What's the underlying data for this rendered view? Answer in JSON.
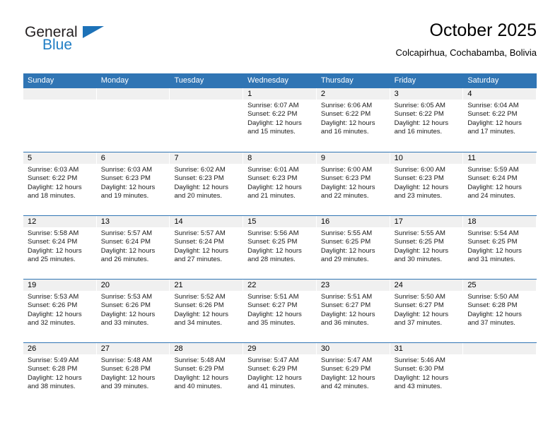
{
  "brand": {
    "name_part1": "General",
    "name_part2": "Blue",
    "triangle_color": "#1d72b8",
    "text_color": "#231f20",
    "blue_color": "#1f7dc4"
  },
  "header": {
    "title": "October 2025",
    "subtitle": "Colcapirhua, Cochabamba, Bolivia"
  },
  "theme": {
    "header_bar": "#3075b4",
    "day_strip": "#f0f0f0",
    "separator": "#3075b4",
    "page_bg": "#ffffff"
  },
  "weekdays": [
    "Sunday",
    "Monday",
    "Tuesday",
    "Wednesday",
    "Thursday",
    "Friday",
    "Saturday"
  ],
  "weeks": [
    [
      {
        "date": "",
        "empty": true,
        "sunrise": "",
        "sunset": "",
        "daylight_line1": "",
        "daylight_line2": ""
      },
      {
        "date": "",
        "empty": true,
        "sunrise": "",
        "sunset": "",
        "daylight_line1": "",
        "daylight_line2": ""
      },
      {
        "date": "",
        "empty": true,
        "sunrise": "",
        "sunset": "",
        "daylight_line1": "",
        "daylight_line2": ""
      },
      {
        "date": "1",
        "empty": false,
        "sunrise": "Sunrise: 6:07 AM",
        "sunset": "Sunset: 6:22 PM",
        "daylight_line1": "Daylight: 12 hours",
        "daylight_line2": "and 15 minutes."
      },
      {
        "date": "2",
        "empty": false,
        "sunrise": "Sunrise: 6:06 AM",
        "sunset": "Sunset: 6:22 PM",
        "daylight_line1": "Daylight: 12 hours",
        "daylight_line2": "and 16 minutes."
      },
      {
        "date": "3",
        "empty": false,
        "sunrise": "Sunrise: 6:05 AM",
        "sunset": "Sunset: 6:22 PM",
        "daylight_line1": "Daylight: 12 hours",
        "daylight_line2": "and 16 minutes."
      },
      {
        "date": "4",
        "empty": false,
        "sunrise": "Sunrise: 6:04 AM",
        "sunset": "Sunset: 6:22 PM",
        "daylight_line1": "Daylight: 12 hours",
        "daylight_line2": "and 17 minutes."
      }
    ],
    [
      {
        "date": "5",
        "empty": false,
        "sunrise": "Sunrise: 6:03 AM",
        "sunset": "Sunset: 6:22 PM",
        "daylight_line1": "Daylight: 12 hours",
        "daylight_line2": "and 18 minutes."
      },
      {
        "date": "6",
        "empty": false,
        "sunrise": "Sunrise: 6:03 AM",
        "sunset": "Sunset: 6:23 PM",
        "daylight_line1": "Daylight: 12 hours",
        "daylight_line2": "and 19 minutes."
      },
      {
        "date": "7",
        "empty": false,
        "sunrise": "Sunrise: 6:02 AM",
        "sunset": "Sunset: 6:23 PM",
        "daylight_line1": "Daylight: 12 hours",
        "daylight_line2": "and 20 minutes."
      },
      {
        "date": "8",
        "empty": false,
        "sunrise": "Sunrise: 6:01 AM",
        "sunset": "Sunset: 6:23 PM",
        "daylight_line1": "Daylight: 12 hours",
        "daylight_line2": "and 21 minutes."
      },
      {
        "date": "9",
        "empty": false,
        "sunrise": "Sunrise: 6:00 AM",
        "sunset": "Sunset: 6:23 PM",
        "daylight_line1": "Daylight: 12 hours",
        "daylight_line2": "and 22 minutes."
      },
      {
        "date": "10",
        "empty": false,
        "sunrise": "Sunrise: 6:00 AM",
        "sunset": "Sunset: 6:23 PM",
        "daylight_line1": "Daylight: 12 hours",
        "daylight_line2": "and 23 minutes."
      },
      {
        "date": "11",
        "empty": false,
        "sunrise": "Sunrise: 5:59 AM",
        "sunset": "Sunset: 6:24 PM",
        "daylight_line1": "Daylight: 12 hours",
        "daylight_line2": "and 24 minutes."
      }
    ],
    [
      {
        "date": "12",
        "empty": false,
        "sunrise": "Sunrise: 5:58 AM",
        "sunset": "Sunset: 6:24 PM",
        "daylight_line1": "Daylight: 12 hours",
        "daylight_line2": "and 25 minutes."
      },
      {
        "date": "13",
        "empty": false,
        "sunrise": "Sunrise: 5:57 AM",
        "sunset": "Sunset: 6:24 PM",
        "daylight_line1": "Daylight: 12 hours",
        "daylight_line2": "and 26 minutes."
      },
      {
        "date": "14",
        "empty": false,
        "sunrise": "Sunrise: 5:57 AM",
        "sunset": "Sunset: 6:24 PM",
        "daylight_line1": "Daylight: 12 hours",
        "daylight_line2": "and 27 minutes."
      },
      {
        "date": "15",
        "empty": false,
        "sunrise": "Sunrise: 5:56 AM",
        "sunset": "Sunset: 6:25 PM",
        "daylight_line1": "Daylight: 12 hours",
        "daylight_line2": "and 28 minutes."
      },
      {
        "date": "16",
        "empty": false,
        "sunrise": "Sunrise: 5:55 AM",
        "sunset": "Sunset: 6:25 PM",
        "daylight_line1": "Daylight: 12 hours",
        "daylight_line2": "and 29 minutes."
      },
      {
        "date": "17",
        "empty": false,
        "sunrise": "Sunrise: 5:55 AM",
        "sunset": "Sunset: 6:25 PM",
        "daylight_line1": "Daylight: 12 hours",
        "daylight_line2": "and 30 minutes."
      },
      {
        "date": "18",
        "empty": false,
        "sunrise": "Sunrise: 5:54 AM",
        "sunset": "Sunset: 6:25 PM",
        "daylight_line1": "Daylight: 12 hours",
        "daylight_line2": "and 31 minutes."
      }
    ],
    [
      {
        "date": "19",
        "empty": false,
        "sunrise": "Sunrise: 5:53 AM",
        "sunset": "Sunset: 6:26 PM",
        "daylight_line1": "Daylight: 12 hours",
        "daylight_line2": "and 32 minutes."
      },
      {
        "date": "20",
        "empty": false,
        "sunrise": "Sunrise: 5:53 AM",
        "sunset": "Sunset: 6:26 PM",
        "daylight_line1": "Daylight: 12 hours",
        "daylight_line2": "and 33 minutes."
      },
      {
        "date": "21",
        "empty": false,
        "sunrise": "Sunrise: 5:52 AM",
        "sunset": "Sunset: 6:26 PM",
        "daylight_line1": "Daylight: 12 hours",
        "daylight_line2": "and 34 minutes."
      },
      {
        "date": "22",
        "empty": false,
        "sunrise": "Sunrise: 5:51 AM",
        "sunset": "Sunset: 6:27 PM",
        "daylight_line1": "Daylight: 12 hours",
        "daylight_line2": "and 35 minutes."
      },
      {
        "date": "23",
        "empty": false,
        "sunrise": "Sunrise: 5:51 AM",
        "sunset": "Sunset: 6:27 PM",
        "daylight_line1": "Daylight: 12 hours",
        "daylight_line2": "and 36 minutes."
      },
      {
        "date": "24",
        "empty": false,
        "sunrise": "Sunrise: 5:50 AM",
        "sunset": "Sunset: 6:27 PM",
        "daylight_line1": "Daylight: 12 hours",
        "daylight_line2": "and 37 minutes."
      },
      {
        "date": "25",
        "empty": false,
        "sunrise": "Sunrise: 5:50 AM",
        "sunset": "Sunset: 6:28 PM",
        "daylight_line1": "Daylight: 12 hours",
        "daylight_line2": "and 37 minutes."
      }
    ],
    [
      {
        "date": "26",
        "empty": false,
        "sunrise": "Sunrise: 5:49 AM",
        "sunset": "Sunset: 6:28 PM",
        "daylight_line1": "Daylight: 12 hours",
        "daylight_line2": "and 38 minutes."
      },
      {
        "date": "27",
        "empty": false,
        "sunrise": "Sunrise: 5:48 AM",
        "sunset": "Sunset: 6:28 PM",
        "daylight_line1": "Daylight: 12 hours",
        "daylight_line2": "and 39 minutes."
      },
      {
        "date": "28",
        "empty": false,
        "sunrise": "Sunrise: 5:48 AM",
        "sunset": "Sunset: 6:29 PM",
        "daylight_line1": "Daylight: 12 hours",
        "daylight_line2": "and 40 minutes."
      },
      {
        "date": "29",
        "empty": false,
        "sunrise": "Sunrise: 5:47 AM",
        "sunset": "Sunset: 6:29 PM",
        "daylight_line1": "Daylight: 12 hours",
        "daylight_line2": "and 41 minutes."
      },
      {
        "date": "30",
        "empty": false,
        "sunrise": "Sunrise: 5:47 AM",
        "sunset": "Sunset: 6:29 PM",
        "daylight_line1": "Daylight: 12 hours",
        "daylight_line2": "and 42 minutes."
      },
      {
        "date": "31",
        "empty": false,
        "sunrise": "Sunrise: 5:46 AM",
        "sunset": "Sunset: 6:30 PM",
        "daylight_line1": "Daylight: 12 hours",
        "daylight_line2": "and 43 minutes."
      },
      {
        "date": "",
        "empty": true,
        "sunrise": "",
        "sunset": "",
        "daylight_line1": "",
        "daylight_line2": ""
      }
    ]
  ]
}
